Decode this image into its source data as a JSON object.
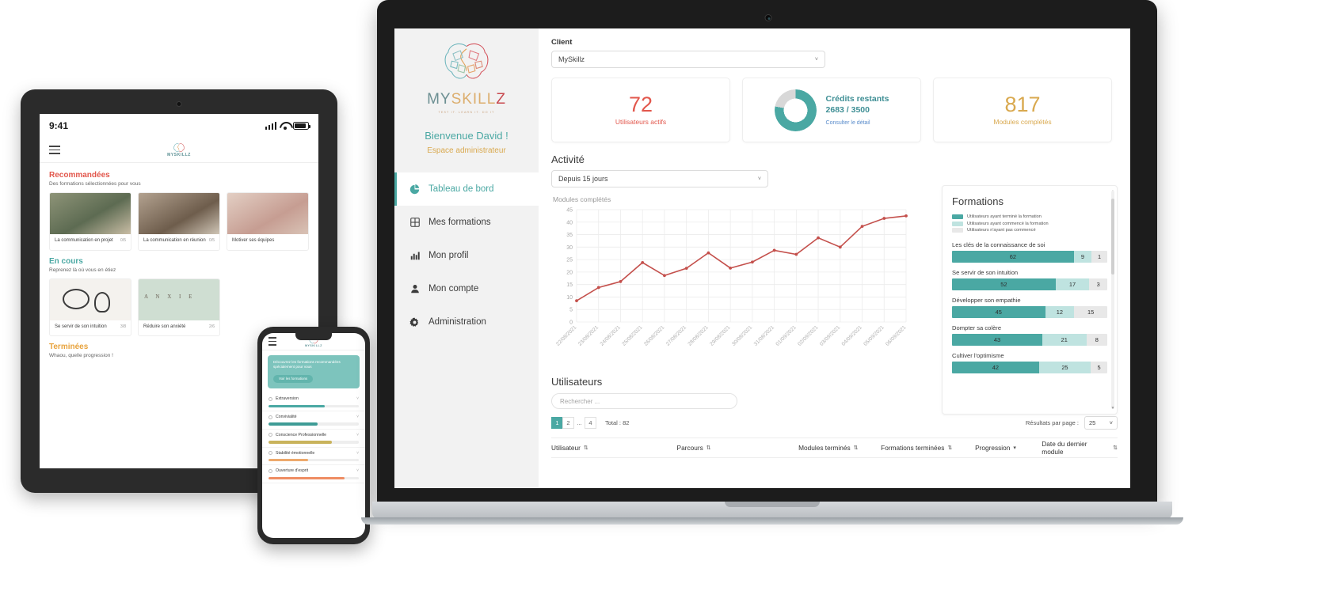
{
  "tablet": {
    "status": {
      "time": "9:41"
    },
    "brand": "MYSKILLZ",
    "sections": [
      {
        "title": "Recommandées",
        "subtitle": "Des formations sélectionnées pour vous",
        "cards": [
          {
            "name": "La communication en projet",
            "progress": "0/5"
          },
          {
            "name": "La communication en réunion",
            "progress": "0/5"
          },
          {
            "name": "Motiver ses équipes",
            "progress": ""
          }
        ]
      },
      {
        "title": "En cours",
        "subtitle": "Reprenez là où vous en étiez",
        "cards": [
          {
            "name": "Se servir de son intuition",
            "progress": "3/8"
          },
          {
            "name": "Réduire son anxiété",
            "progress": "2/6"
          }
        ]
      },
      {
        "title": "Terminées",
        "subtitle": "Whaou, quelle progression !",
        "cards": []
      }
    ]
  },
  "phone": {
    "brand": "MYSKILLZ",
    "banner": {
      "text": "Découvrez les formations recommandées spécialement pour vous",
      "button": "Voir les formations"
    },
    "traits": [
      {
        "name": "Extraversion",
        "color": "#4aa8a3",
        "pct": 62
      },
      {
        "name": "Convivialité",
        "color": "#3e9b95",
        "pct": 54
      },
      {
        "name": "Conscience Professionnelle",
        "color": "#c9b35c",
        "pct": 70
      },
      {
        "name": "Stabilité émotionnelle",
        "color": "#eda96c",
        "pct": 44
      },
      {
        "name": "Ouverture d'esprit",
        "color": "#ef8d63",
        "pct": 84
      }
    ]
  },
  "app": {
    "sidebar": {
      "logo_word_parts": [
        "MYSKILL",
        "Z"
      ],
      "logo_tagline": "TEST IT. LEARN IT. DO IT",
      "welcome": "Bienvenue David !",
      "role": "Espace administrateur",
      "nav": [
        {
          "label": "Tableau de bord",
          "icon": "pie-chart-icon",
          "active": true
        },
        {
          "label": "Mes formations",
          "icon": "grid-icon",
          "active": false
        },
        {
          "label": "Mon profil",
          "icon": "bar-chart-icon",
          "active": false
        },
        {
          "label": "Mon compte",
          "icon": "user-icon",
          "active": false
        },
        {
          "label": "Administration",
          "icon": "gear-icon",
          "active": false
        }
      ]
    },
    "client": {
      "label": "Client",
      "selected": "MySkillz"
    },
    "kpis": {
      "active_users": {
        "value": "72",
        "caption": "Utilisateurs actifs",
        "color": "#e2574c"
      },
      "credits": {
        "title": "Crédits restants",
        "value": "2683 / 3500",
        "link": "Consulter le détail",
        "used_pct": 78,
        "color": "#4aa8a3"
      },
      "modules": {
        "value": "817",
        "caption": "Modules complétés",
        "color": "#d9a94f"
      }
    },
    "activity": {
      "title": "Activité",
      "period_selected": "Depuis 15 jours"
    },
    "formations": {
      "title": "Formations",
      "legend": [
        {
          "label": "Utilisateurs ayant terminé la formation",
          "color": "#4aa8a3"
        },
        {
          "label": "Utilisateurs ayant commencé la formation",
          "color": "#bfe3e0"
        },
        {
          "label": "Utilisateurs n'ayant pas commencé",
          "color": "#e8e8e8"
        }
      ],
      "rows": [
        {
          "name": "Les clés de la connaissance de soi",
          "finished": 62,
          "started": 9,
          "notstarted": 1
        },
        {
          "name": "Se servir de son intuition",
          "finished": 52,
          "started": 17,
          "notstarted": 3
        },
        {
          "name": "Développer son empathie",
          "finished": 45,
          "started": 12,
          "notstarted": 15
        },
        {
          "name": "Dompter sa colère",
          "finished": 43,
          "started": 21,
          "notstarted": 8
        },
        {
          "name": "Cultiver l'optimisme",
          "finished": 42,
          "started": 25,
          "notstarted": 5
        }
      ]
    },
    "users": {
      "title": "Utilisateurs",
      "search_placeholder": "Rechercher ...",
      "pages": [
        "1",
        "2",
        "...",
        "4"
      ],
      "current_page": "1",
      "total_label": "Total : 82",
      "per_page_label": "Résultats par page :",
      "per_page_value": "25",
      "columns": [
        {
          "label": "Utilisateur",
          "sort": "both"
        },
        {
          "label": "Parcours",
          "sort": "both"
        },
        {
          "label": "Modules terminés",
          "sort": "both"
        },
        {
          "label": "Formations terminées",
          "sort": "both"
        },
        {
          "label": "Progression",
          "sort": "desc"
        },
        {
          "label": "Date du dernier module",
          "sort": "both"
        }
      ]
    }
  },
  "chart_data": {
    "type": "line",
    "title": "Modules complétés",
    "xlabel": "",
    "ylabel": "",
    "ylim": [
      0,
      45
    ],
    "yticks": [
      0,
      5,
      10,
      15,
      20,
      25,
      30,
      35,
      40,
      45
    ],
    "grid": true,
    "line_color": "#c4504c",
    "categories": [
      "22/08/2021",
      "23/08/2021",
      "24/08/2021",
      "25/08/2021",
      "26/08/2021",
      "27/08/2021",
      "28/08/2021",
      "29/08/2021",
      "30/08/2021",
      "31/08/2021",
      "01/09/2021",
      "02/09/2021",
      "03/09/2021",
      "04/09/2021",
      "05/09/2021",
      "06/09/2021"
    ],
    "values": [
      8.5,
      13.8,
      16.2,
      23.8,
      18.6,
      21.5,
      27.7,
      21.6,
      24,
      28.7,
      27.1,
      33.7,
      30,
      38.3,
      41.5,
      42.5
    ],
    "series": [
      {
        "name": "Modules complétés",
        "values": [
          8.5,
          13.8,
          16.2,
          23.8,
          18.6,
          21.5,
          27.7,
          21.6,
          24,
          28.7,
          27.1,
          33.7,
          30,
          38.3,
          41.5,
          42.5
        ]
      }
    ]
  }
}
